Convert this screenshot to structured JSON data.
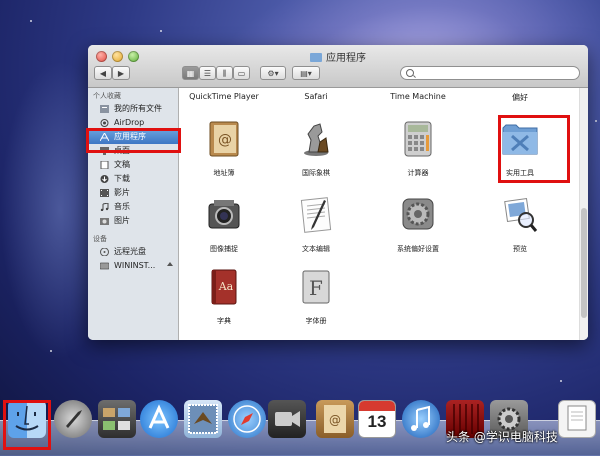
{
  "window": {
    "title": "应用程序",
    "search_placeholder": ""
  },
  "sidebar": {
    "section_favorites": "个人收藏",
    "items": [
      {
        "label": "我的所有文件",
        "icon": "all-files-icon"
      },
      {
        "label": "AirDrop",
        "icon": "airdrop-icon"
      },
      {
        "label": "应用程序",
        "icon": "applications-icon"
      },
      {
        "label": "桌面",
        "icon": "desktop-icon"
      },
      {
        "label": "文稿",
        "icon": "documents-icon"
      },
      {
        "label": "下载",
        "icon": "downloads-icon"
      },
      {
        "label": "影片",
        "icon": "movies-icon"
      },
      {
        "label": "音乐",
        "icon": "music-icon"
      },
      {
        "label": "图片",
        "icon": "pictures-icon"
      }
    ],
    "section_devices": "设备",
    "devices": [
      {
        "label": "远程光盘",
        "icon": "remote-disc-icon"
      },
      {
        "label": "WININST...",
        "icon": "drive-icon"
      }
    ]
  },
  "content": {
    "top_row": [
      "QuickTime Player",
      "Safari",
      "Time Machine",
      "偏好"
    ],
    "apps": [
      {
        "label": "地址簿",
        "icon": "address-book-icon"
      },
      {
        "label": "国际象棋",
        "icon": "chess-icon"
      },
      {
        "label": "计算器",
        "icon": "calculator-icon"
      },
      {
        "label": "实用工具",
        "icon": "utilities-folder-icon"
      },
      {
        "label": "图像捕捉",
        "icon": "image-capture-icon"
      },
      {
        "label": "文本编辑",
        "icon": "textedit-icon"
      },
      {
        "label": "系统偏好设置",
        "icon": "system-preferences-icon"
      },
      {
        "label": "预览",
        "icon": "preview-icon"
      },
      {
        "label": "字典",
        "icon": "dictionary-icon"
      },
      {
        "label": "字体册",
        "icon": "font-book-icon"
      }
    ]
  },
  "dock": {
    "calendar_day": "13",
    "icons": [
      "finder-icon",
      "launchpad-icon",
      "mission-control-icon",
      "app-store-icon",
      "mail-icon",
      "safari-icon",
      "facetime-icon",
      "contacts-icon",
      "calendar-icon",
      "itunes-icon",
      "photo-booth-icon",
      "system-preferences-icon",
      "documents-stack-icon"
    ]
  },
  "watermark": "头条 @学识电脑科技",
  "colors": {
    "selection": "#3d76c4",
    "annotation": "#e01010"
  }
}
